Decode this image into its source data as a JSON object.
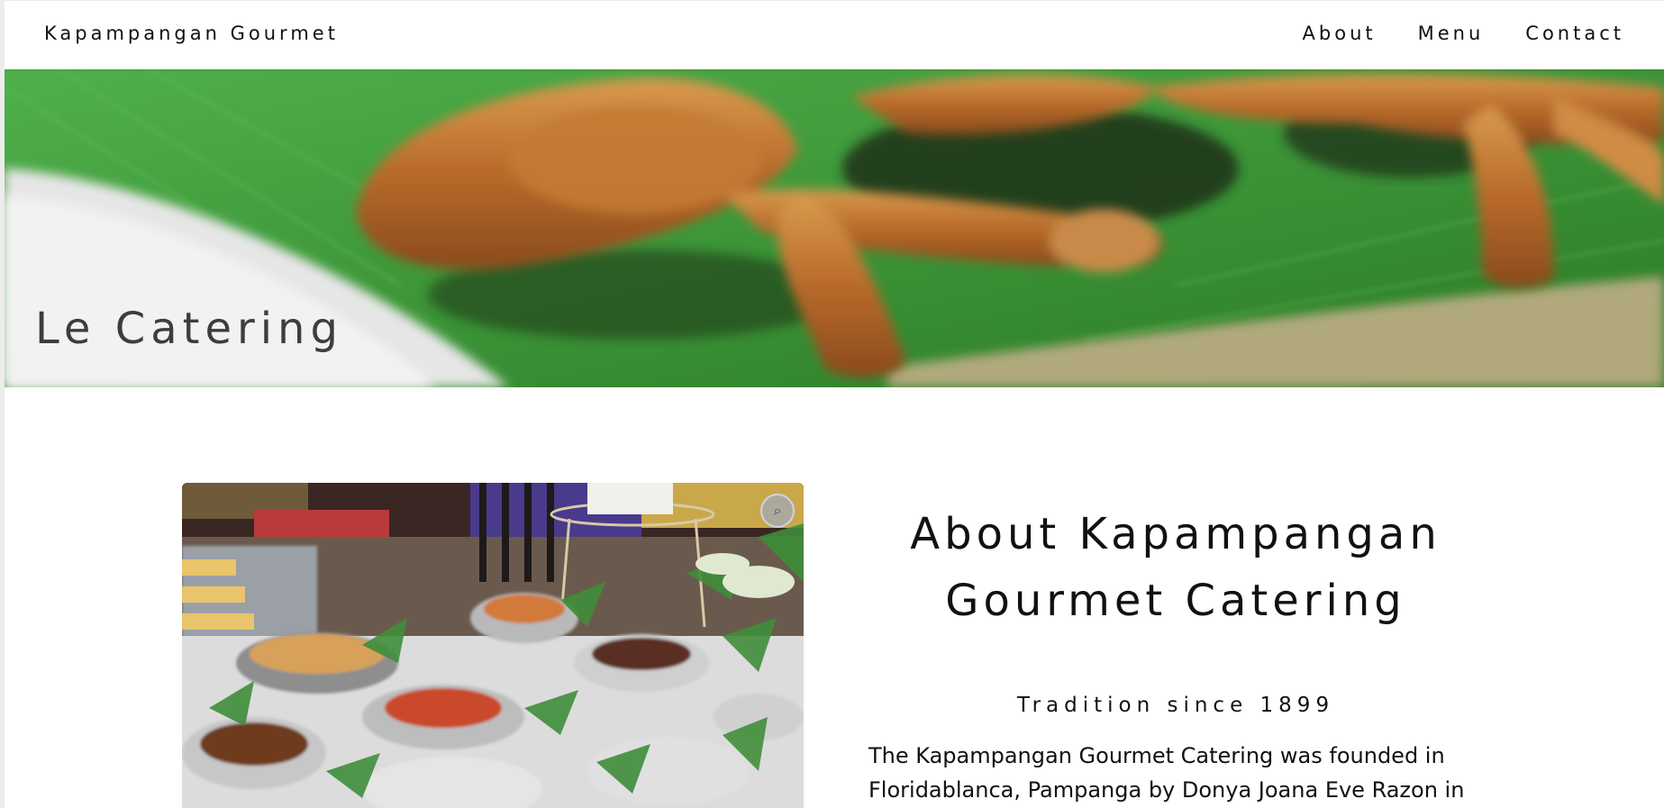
{
  "header": {
    "brand": "Kapampangan Gourmet",
    "nav": [
      {
        "label": "About"
      },
      {
        "label": "Menu"
      },
      {
        "label": "Contact"
      }
    ]
  },
  "hero": {
    "title": "Le Catering"
  },
  "about": {
    "heading": "About Kapampangan Gourmet Catering",
    "subtitle": "Tradition since 1899",
    "body": "The Kapampangan Gourmet Catering was founded in Floridablanca, Pampanga by Donya Joana Eve Razon in"
  },
  "icons": {
    "photo_badge": "image-search-icon"
  },
  "colors": {
    "background": "#ffffff",
    "text": "#111111",
    "hero_title": "#3d3d3d",
    "leaf_green": "#3fa33a"
  }
}
